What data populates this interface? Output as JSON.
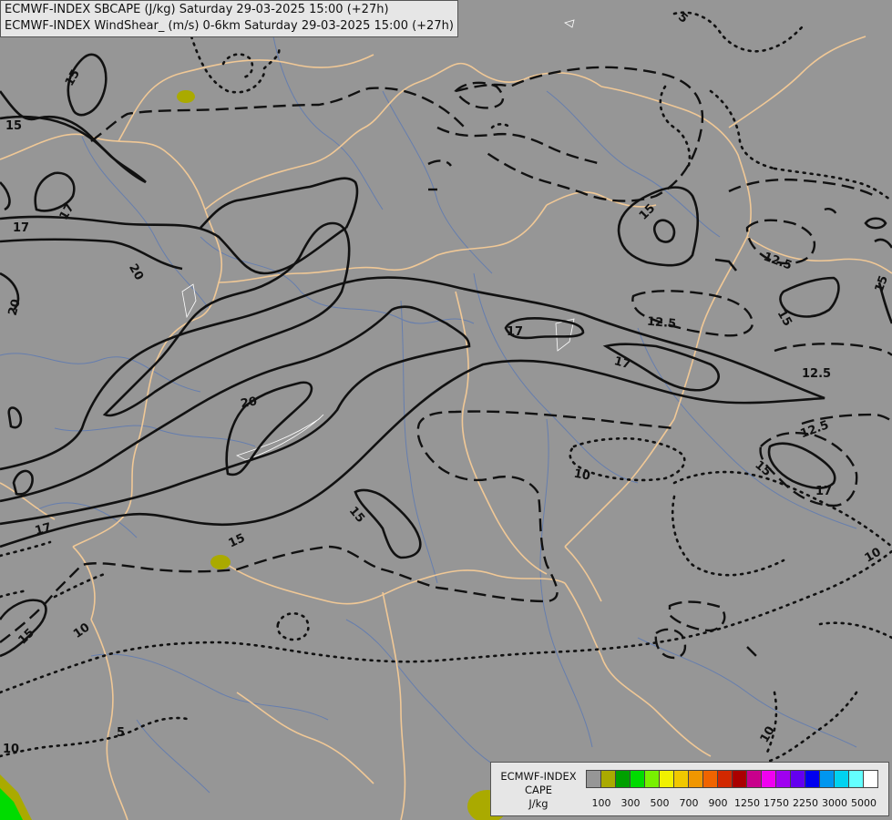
{
  "header": {
    "line1": "ECMWF-INDEX SBCAPE (J/kg) Saturday 29-03-2025 15:00 (+27h)",
    "line2": "ECMWF-INDEX WindShear_ (m/s) 0-6km Saturday 29-03-2025 15:00 (+27h)"
  },
  "legend": {
    "title_line1": "ECMWF-INDEX",
    "title_line2": "CAPE",
    "unit": "J/kg",
    "colors": [
      "#969696",
      "#aaaa00",
      "#00a000",
      "#00dc00",
      "#78f000",
      "#f0f000",
      "#f0c800",
      "#f09600",
      "#f06400",
      "#d22800",
      "#aa0000",
      "#c8008c",
      "#f000f0",
      "#a000f0",
      "#6400f0",
      "#0000f0",
      "#0096f0",
      "#00d2f0",
      "#64ffff",
      "#ffffff"
    ],
    "tick_labels": [
      "100",
      "300",
      "500",
      "700",
      "900",
      "1250",
      "1750",
      "2250",
      "3000",
      "5000"
    ]
  },
  "contour_labels": {
    "l15a": "15",
    "l15b": "15",
    "l15c": "15",
    "l15d": "15",
    "l15e": "15",
    "l15f": "15",
    "l15g": "15",
    "l15h": "15",
    "l17a": "17",
    "l17b": "17",
    "l17c": "17",
    "l17d": "17",
    "l17e": "17",
    "l17f": "17",
    "l20a": "20",
    "l20b": "20",
    "l20c": "20",
    "l125a": "12.5",
    "l125b": "12.5",
    "l125c": "12.5",
    "l125d": "12.5",
    "l10a": "10",
    "l10b": "10",
    "l10c": "10",
    "l10d": "10",
    "l10e": "10",
    "l5a": "5",
    "l5b": "5"
  }
}
